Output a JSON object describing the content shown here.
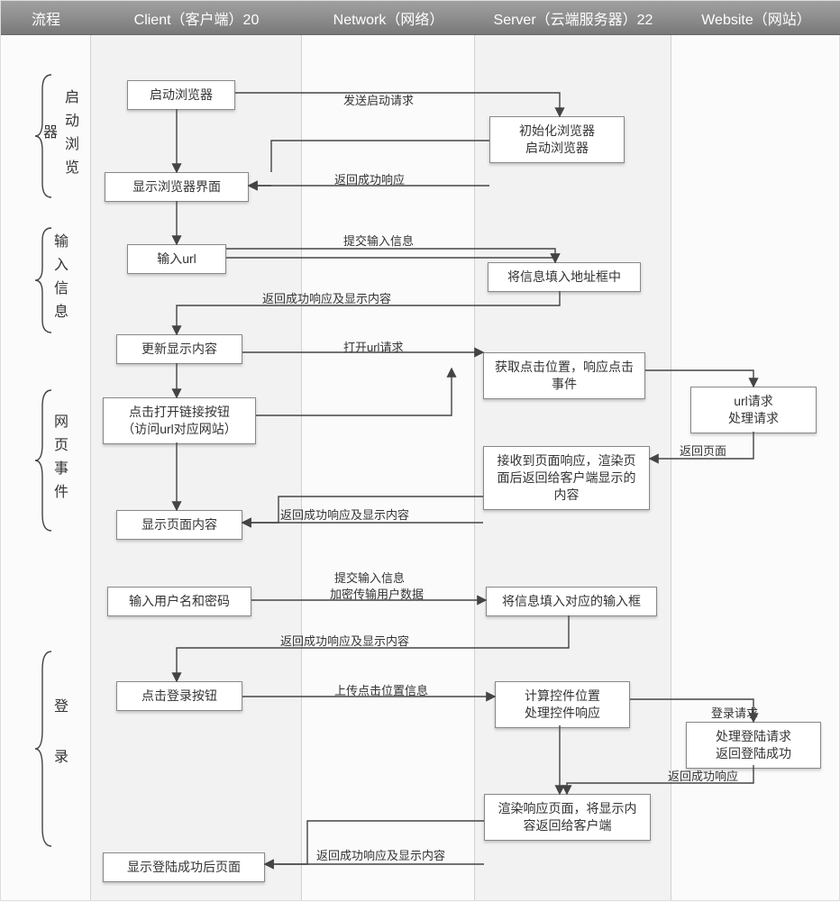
{
  "header": {
    "process": "流程",
    "client": "Client（客户端）20",
    "network": "Network（网络）",
    "server": "Server（云端服务器）22",
    "website": "Website（网站）"
  },
  "phases": {
    "start_browser": "启动浏览器",
    "input_info": "输入信息",
    "page_event": "网页事件",
    "login": "登录"
  },
  "nodes": {
    "c1": "启动浏览器",
    "s1a": "初始化浏览器",
    "s1b": "启动浏览器",
    "c2": "显示浏览器界面",
    "c3": "输入url",
    "s3": "将信息填入地址框中",
    "c4": "更新显示内容",
    "c5a": "点击打开链接按钮",
    "c5b": "（访问url对应网站）",
    "s5a": "获取点击位置，响应点击事件",
    "w5a": "url请求",
    "w5b": "处理请求",
    "s6": "接收到页面响应，渲染页面后返回给客户端显示的内容",
    "c6": "显示页面内容",
    "c7": "输入用户名和密码",
    "s7": "将信息填入对应的输入框",
    "c8": "点击登录按钮",
    "s8a": "计算控件位置",
    "s8b": "处理控件响应",
    "w8a": "登录请求",
    "w8b1": "处理登陆请求",
    "w8b2": "返回登陆成功",
    "s9": "渲染响应页面，将显示内容返回给客户端",
    "c9": "显示登陆成功后页面"
  },
  "edges": {
    "e1": "发送启动请求",
    "e2": "返回成功响应",
    "e3": "提交输入信息",
    "e4": "返回成功响应及显示内容",
    "e5": "打开url请求",
    "e6": "返回页面",
    "e7": "返回成功响应及显示内容",
    "e8a": "提交输入信息",
    "e8b": "加密传输用户数据",
    "e9": "返回成功响应及显示内容",
    "e10": "上传点击位置信息",
    "e11": "返回成功响应",
    "e12": "返回成功响应及显示内容"
  }
}
